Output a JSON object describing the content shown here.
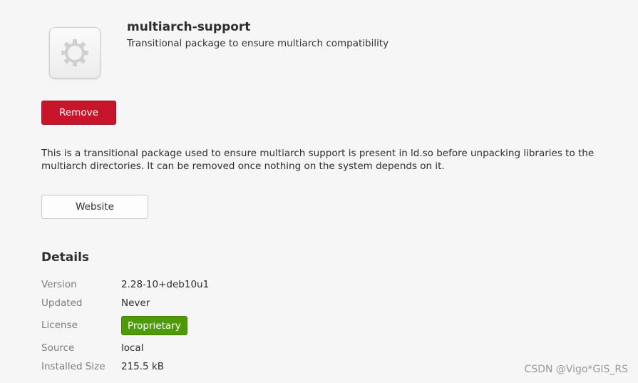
{
  "app": {
    "name": "multiarch-support",
    "summary": "Transitional package to ensure multiarch compatibility",
    "icon": "gear-icon"
  },
  "actions": {
    "remove_label": "Remove",
    "website_label": "Website"
  },
  "description": {
    "line1": "This is a transitional package used to ensure multiarch support is present in ld.so before unpacking libraries to the",
    "line2": "multiarch directories.  It can be removed once nothing on the system depends on it."
  },
  "details": {
    "heading": "Details",
    "rows": [
      {
        "label": "Version",
        "value": "2.28-10+deb10u1"
      },
      {
        "label": "Updated",
        "value": "Never"
      },
      {
        "label": "License",
        "value": "Proprietary"
      },
      {
        "label": "Source",
        "value": "local"
      },
      {
        "label": "Installed Size",
        "value": "215.5 kB"
      }
    ]
  },
  "watermark": "CSDN @Vigo*GIS_RS",
  "colors": {
    "remove": "#c7162b",
    "license_badge": "#4e9a06",
    "background": "#f6f6f6"
  }
}
